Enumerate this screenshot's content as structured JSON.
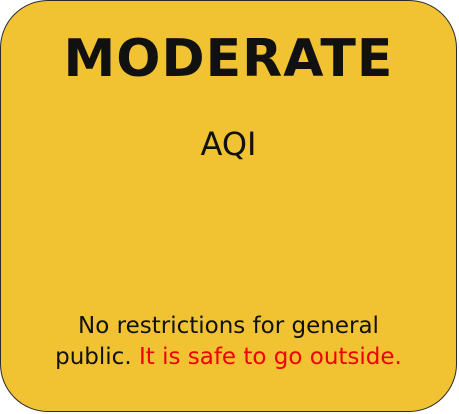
{
  "aqi_card": {
    "status_label": "MODERATE",
    "metric_label": "AQI",
    "message_line1": "No restrictions for general",
    "message_line2_prefix": "public. ",
    "message_highlight": "It is safe to go outside.",
    "colors": {
      "background": "#f1c232",
      "highlight": "#f00000"
    }
  }
}
